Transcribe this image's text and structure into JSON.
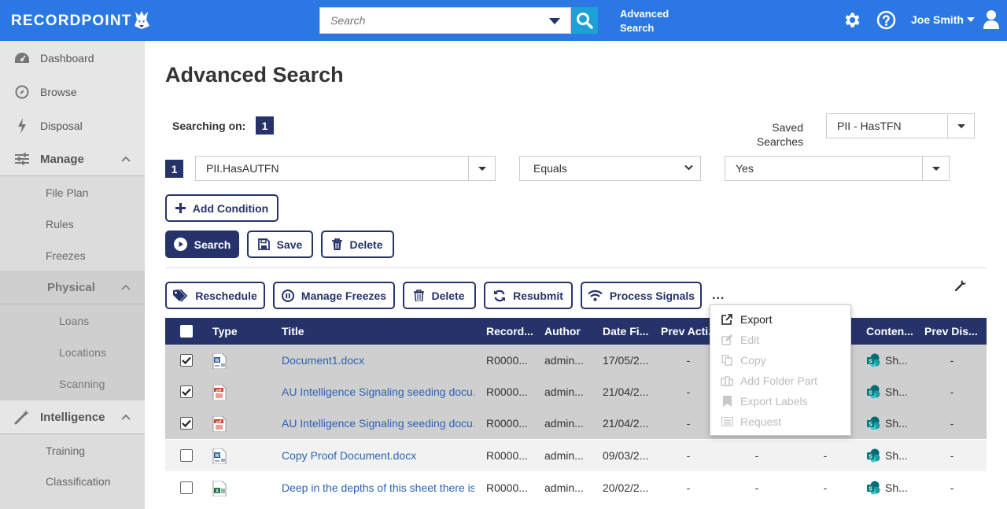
{
  "header": {
    "logo": "RECORDPOINT",
    "search_placeholder": "Search",
    "advanced_search_link": "Advanced Search",
    "user_name": "Joe Smith"
  },
  "sidebar": {
    "dashboard": "Dashboard",
    "browse": "Browse",
    "disposal": "Disposal",
    "manage": "Manage",
    "manage_items": [
      "File Plan",
      "Rules",
      "Freezes"
    ],
    "physical": "Physical",
    "physical_items": [
      "Loans",
      "Locations",
      "Scanning"
    ],
    "intelligence": "Intelligence",
    "intelligence_items": [
      "Training",
      "Classification"
    ]
  },
  "main": {
    "title": "Advanced Search",
    "searching_on_label": "Searching on:",
    "searching_on_count": "1",
    "saved_searches_label": "Saved Searches",
    "saved_search_value": "PII - HasTFN",
    "condition": {
      "index": "1",
      "field": "PII.HasAUTFN",
      "operator": "Equals",
      "value": "Yes"
    },
    "add_condition": "Add Condition",
    "actions": {
      "search": "Search",
      "save": "Save",
      "delete": "Delete"
    },
    "toolbar": {
      "reschedule": "Reschedule",
      "manage_freezes": "Manage Freezes",
      "delete": "Delete",
      "resubmit": "Resubmit",
      "process_signals": "Process Signals",
      "more": "..."
    }
  },
  "table": {
    "headers": {
      "type": "Type",
      "title": "Title",
      "record": "Record...",
      "author": "Author",
      "date_filed": "Date Fi...",
      "prev_action": "Prev Acti...",
      "content": "Conten...",
      "prev_disposal": "Prev Dis..."
    },
    "rows": [
      {
        "checked": true,
        "type": "word",
        "title": "Document1.docx",
        "record": "R0000...",
        "author": "admin...",
        "date": "17/05/2...",
        "prev_action": "-",
        "col6": "",
        "col7": "",
        "content": "Sh...",
        "prev_disposal": "-"
      },
      {
        "checked": true,
        "type": "pdf",
        "title": "AU Intelligence Signaling seeding docu...",
        "record": "R0000...",
        "author": "admin...",
        "date": "21/04/2...",
        "prev_action": "-",
        "col6": "",
        "col7": "",
        "content": "Sh...",
        "prev_disposal": "-"
      },
      {
        "checked": true,
        "type": "pdf",
        "title": "AU Intelligence Signaling seeding docu...",
        "record": "R0000...",
        "author": "admin...",
        "date": "21/04/2...",
        "prev_action": "-",
        "col6": "",
        "col7": "",
        "content": "Sh...",
        "prev_disposal": "-"
      },
      {
        "checked": false,
        "type": "word",
        "title": "Copy Proof Document.docx",
        "record": "R0000...",
        "author": "admin...",
        "date": "09/03/2...",
        "prev_action": "-",
        "col6": "-",
        "col7": "-",
        "content": "Sh...",
        "prev_disposal": "-"
      },
      {
        "checked": false,
        "type": "excel",
        "title": "Deep in the depths of this sheet there is...",
        "record": "R0000...",
        "author": "admin...",
        "date": "20/02/2...",
        "prev_action": "-",
        "col6": "-",
        "col7": "-",
        "content": "Sh...",
        "prev_disposal": "-"
      }
    ]
  },
  "context_menu": {
    "items": [
      {
        "label": "Export",
        "enabled": true,
        "icon": "external-link-icon"
      },
      {
        "label": "Edit",
        "enabled": false,
        "icon": "edit-icon"
      },
      {
        "label": "Copy",
        "enabled": false,
        "icon": "copy-icon"
      },
      {
        "label": "Add Folder Part",
        "enabled": false,
        "icon": "folder-part-icon"
      },
      {
        "label": "Export Labels",
        "enabled": false,
        "icon": "bookmark-icon"
      },
      {
        "label": "Request",
        "enabled": false,
        "icon": "list-icon"
      }
    ]
  },
  "colors": {
    "topbar": "#2b78e4",
    "navy": "#26336b",
    "link": "#2a63b7",
    "search_button": "#1ca0d6"
  }
}
